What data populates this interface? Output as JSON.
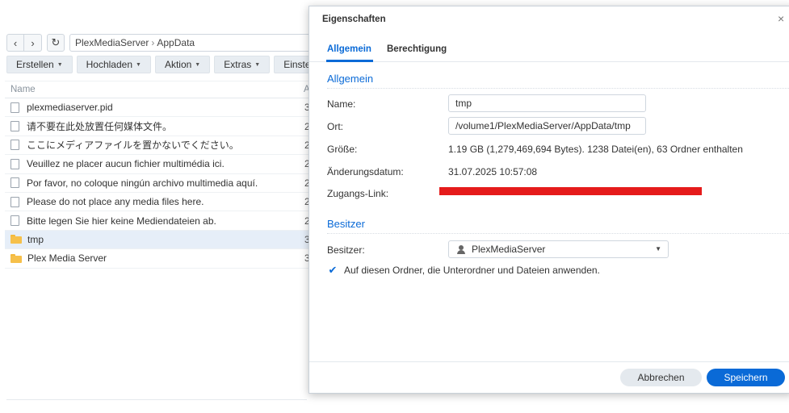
{
  "file_manager": {
    "path": {
      "root": "PlexMediaServer",
      "separator": "›",
      "current": "AppData"
    },
    "toolbar": [
      {
        "label": "Erstellen"
      },
      {
        "label": "Hochladen"
      },
      {
        "label": "Aktion"
      },
      {
        "label": "Extras"
      },
      {
        "label": "Einstellu"
      }
    ],
    "columns": {
      "name": "Name",
      "second": "A"
    },
    "rows": [
      {
        "type": "file",
        "name": "plexmediaserver.pid",
        "col2": "3"
      },
      {
        "type": "file",
        "name": "请不要在此处放置任何媒体文件。",
        "col2": "2"
      },
      {
        "type": "file",
        "name": "ここにメディアファイルを置かないでください。",
        "col2": "2"
      },
      {
        "type": "file",
        "name": "Veuillez ne placer aucun fichier multimédia ici.",
        "col2": "2"
      },
      {
        "type": "file",
        "name": "Por favor, no coloque ningún archivo multimedia aquí.",
        "col2": "2"
      },
      {
        "type": "file",
        "name": "Please do not place any media files here.",
        "col2": "2"
      },
      {
        "type": "file",
        "name": "Bitte legen Sie hier keine Mediendateien ab.",
        "col2": "2"
      },
      {
        "type": "folder",
        "name": "tmp",
        "col2": "3",
        "selected": true
      },
      {
        "type": "folder",
        "name": "Plex Media Server",
        "col2": "3"
      }
    ]
  },
  "dialog": {
    "title": "Eigenschaften",
    "close": "×",
    "tabs": [
      {
        "label": "Allgemein",
        "active": true
      },
      {
        "label": "Berechtigung",
        "active": false
      }
    ],
    "general": {
      "section_title": "Allgemein",
      "name_label": "Name:",
      "name_value": "tmp",
      "location_label": "Ort:",
      "location_value": "/volume1/PlexMediaServer/AppData/tmp",
      "size_label": "Größe:",
      "size_value": "1.19 GB (1,279,469,694 Bytes). 1238 Datei(en), 63 Ordner enthalten",
      "modified_label": "Änderungsdatum:",
      "modified_value": "31.07.2025 10:57:08",
      "link_label": "Zugangs-Link:"
    },
    "owner": {
      "section_title": "Besitzer",
      "owner_label": "Besitzer:",
      "owner_value": "PlexMediaServer",
      "apply_label": "Auf diesen Ordner, die Unterordner und Dateien anwenden.",
      "apply_checked": true
    },
    "buttons": {
      "cancel": "Abbrechen",
      "save": "Speichern"
    }
  },
  "colors": {
    "accent": "#0a6ad7",
    "redaction": "#e51b1b",
    "folder": "#f6c04a"
  }
}
